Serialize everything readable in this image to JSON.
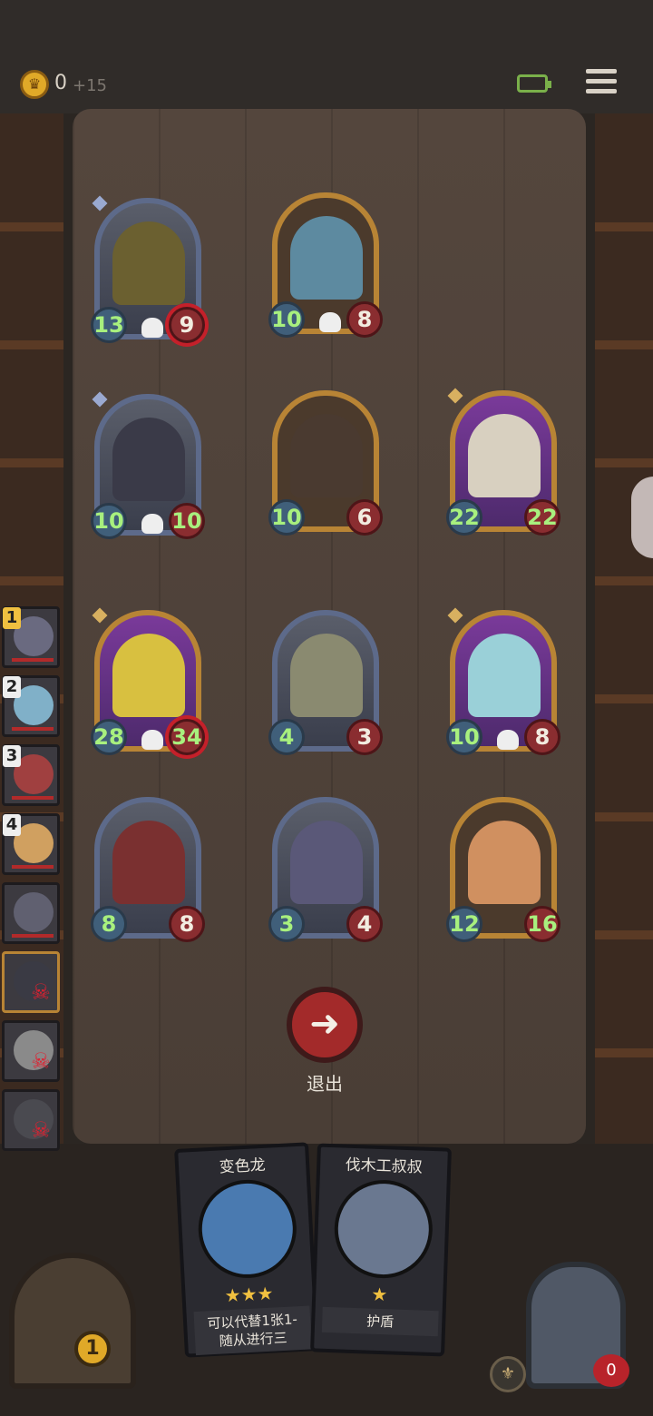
{
  "topbar": {
    "coins": "0",
    "coin_income": "+15"
  },
  "board_cards": [
    {
      "atk": "13",
      "hp": "9",
      "hp_target": true,
      "frame": "steel",
      "gem": "blue",
      "portrait": "#6b6030",
      "skull": true
    },
    {
      "atk": "10",
      "hp": "8",
      "hp_target": false,
      "frame": "gold",
      "gem": "",
      "portrait": "#5d8aa0",
      "skull": true
    },
    {
      "atk": "10",
      "hp": "10",
      "hp_target": false,
      "frame": "steel",
      "gem": "blue",
      "portrait": "#3a3a48",
      "skull": true,
      "hp_green": true
    },
    {
      "atk": "10",
      "hp": "6",
      "hp_target": false,
      "frame": "gold",
      "gem": "",
      "portrait": "#4a3a30",
      "skull": false
    },
    {
      "atk": "22",
      "hp": "22",
      "hp_target": false,
      "frame": "purple",
      "gem": "gold",
      "portrait": "#d8d0c0",
      "skull": false,
      "hp_green": true
    },
    {
      "atk": "28",
      "hp": "34",
      "hp_target": true,
      "frame": "purple",
      "gem": "gold",
      "portrait": "#d8c040",
      "skull": true,
      "hp_green": true
    },
    {
      "atk": "4",
      "hp": "3",
      "hp_target": false,
      "frame": "steel",
      "gem": "",
      "portrait": "#8a8a70",
      "skull": false
    },
    {
      "atk": "10",
      "hp": "8",
      "hp_target": false,
      "frame": "purple",
      "gem": "gold",
      "portrait": "#9ad0d8",
      "skull": true
    },
    {
      "atk": "8",
      "hp": "8",
      "hp_target": false,
      "frame": "steel",
      "gem": "",
      "portrait": "#7a3030",
      "skull": false
    },
    {
      "atk": "3",
      "hp": "4",
      "hp_target": false,
      "frame": "steel",
      "gem": "",
      "portrait": "#5a5878",
      "skull": false
    },
    {
      "atk": "12",
      "hp": "16",
      "hp_target": false,
      "frame": "gold",
      "gem": "",
      "portrait": "#d09060",
      "skull": false,
      "hp_green": true
    }
  ],
  "team": [
    {
      "num": "1",
      "num_gold": true,
      "face": "#6a6a80",
      "alive": true
    },
    {
      "num": "2",
      "num_gold": false,
      "face": "#80b0c8",
      "alive": true
    },
    {
      "num": "3",
      "num_gold": false,
      "face": "#a04040",
      "alive": true
    },
    {
      "num": "4",
      "num_gold": false,
      "face": "#d0a060",
      "alive": true
    },
    {
      "num": "",
      "num_gold": false,
      "face": "#606070",
      "alive": true
    },
    {
      "num": "",
      "num_gold": false,
      "face": "#3a3a44",
      "alive": false,
      "selected": true
    },
    {
      "num": "",
      "num_gold": false,
      "face": "#8a8a8a",
      "alive": false
    },
    {
      "num": "",
      "num_gold": false,
      "face": "#4a4a50",
      "alive": false
    }
  ],
  "exit": {
    "label": "退出",
    "icon": "arrow-left"
  },
  "hand": [
    {
      "title": "变色龙",
      "stars": "★★★",
      "desc_line1": "可以代替1张1-",
      "desc_line2": "随从进行三",
      "art": "#4a7ab0"
    },
    {
      "title": "伐木工叔叔",
      "stars": "★",
      "desc_line1": "护盾",
      "desc_line2": "",
      "art": "#6a7890"
    }
  ],
  "footer": {
    "level": "1",
    "lives": "0"
  },
  "colors": {
    "accent_gold": "#b88435",
    "atk_green": "#a8f07e",
    "hp_red": "#8a2d30"
  }
}
